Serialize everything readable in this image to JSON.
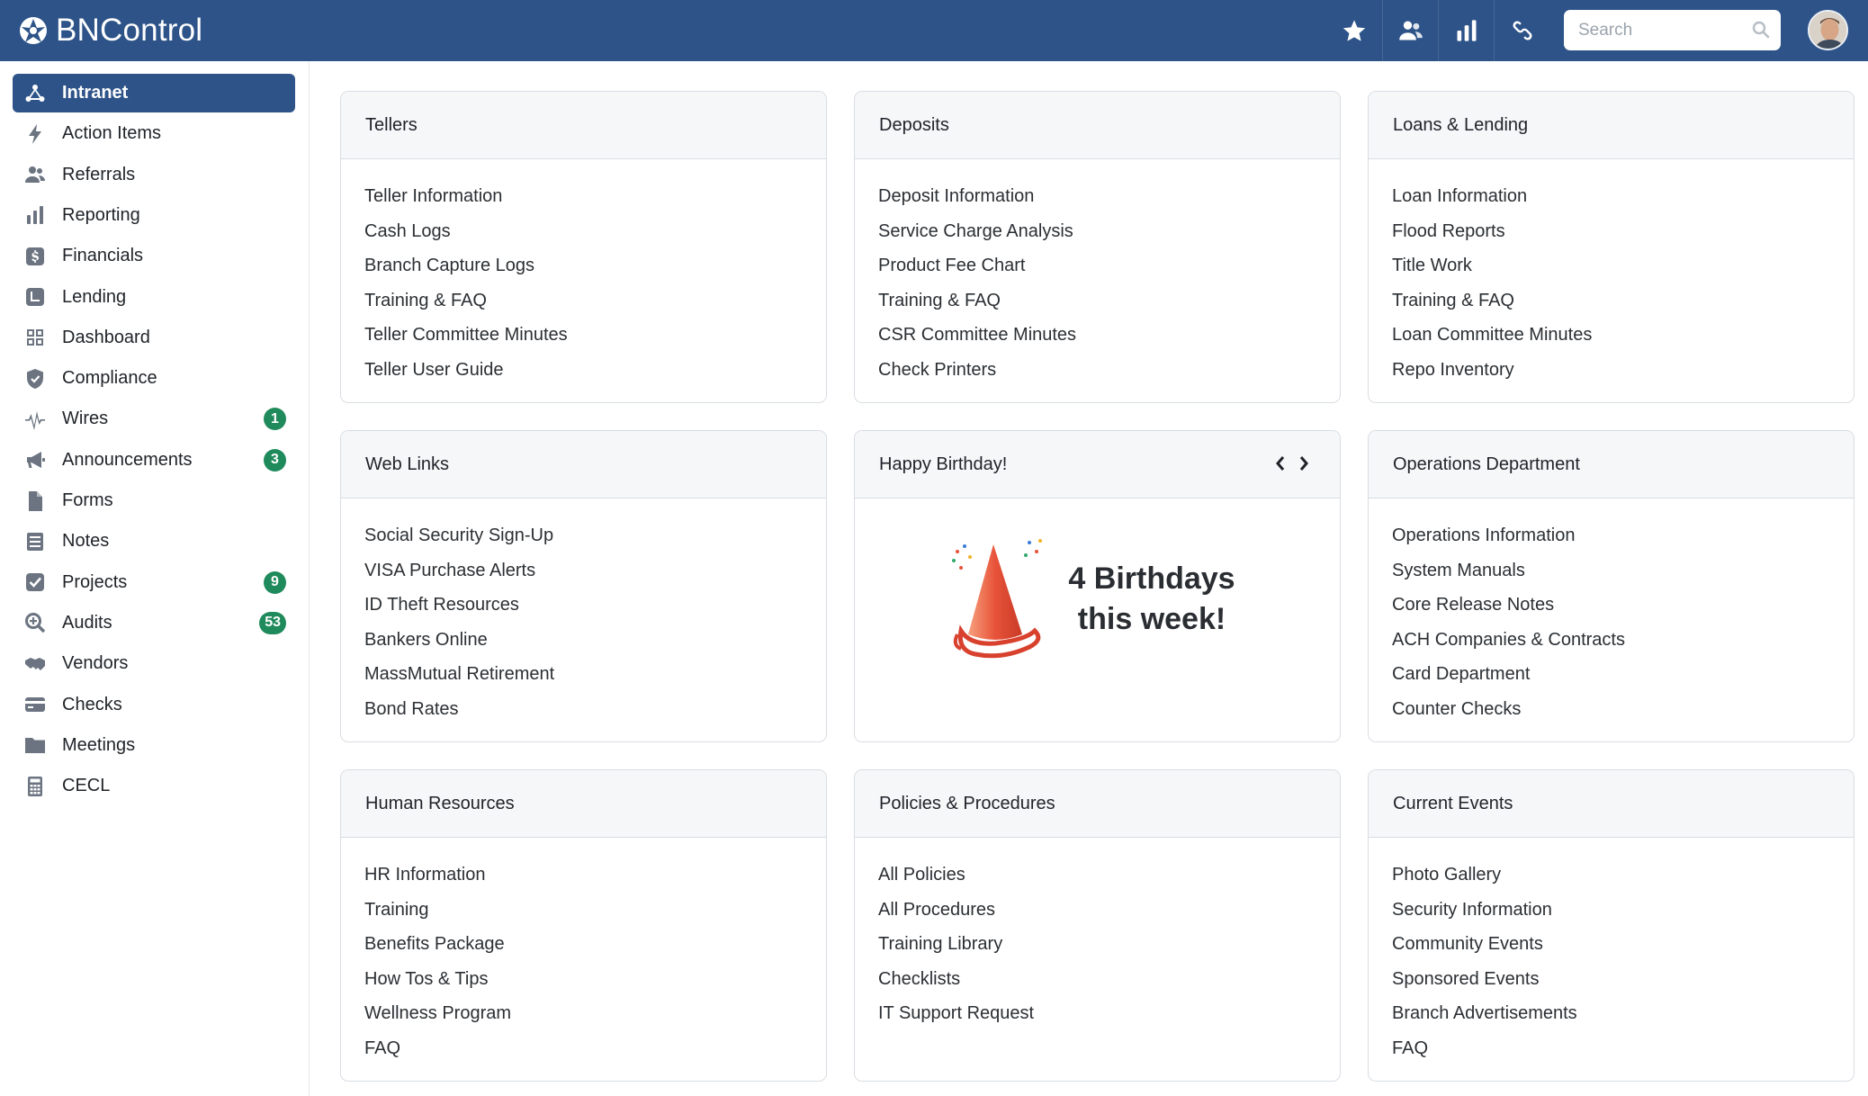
{
  "app": {
    "name": "BNControl"
  },
  "topbar": {
    "icons": [
      "star-icon",
      "users-icon",
      "bar-chart-icon",
      "link-icon"
    ],
    "search": {
      "placeholder": "Search",
      "value": ""
    }
  },
  "sidebar": {
    "items": [
      {
        "label": "Intranet",
        "icon": "network-icon",
        "active": true,
        "badge": ""
      },
      {
        "label": "Action Items",
        "icon": "bolt-icon",
        "badge": ""
      },
      {
        "label": "Referrals",
        "icon": "users-icon",
        "badge": ""
      },
      {
        "label": "Reporting",
        "icon": "bar-chart-icon",
        "badge": ""
      },
      {
        "label": "Financials",
        "icon": "dollar-icon",
        "badge": ""
      },
      {
        "label": "Lending",
        "icon": "lending-icon",
        "badge": ""
      },
      {
        "label": "Dashboard",
        "icon": "grid-icon",
        "badge": ""
      },
      {
        "label": "Compliance",
        "icon": "shield-icon",
        "badge": ""
      },
      {
        "label": "Wires",
        "icon": "pulse-icon",
        "badge": "1"
      },
      {
        "label": "Announcements",
        "icon": "megaphone-icon",
        "badge": "3"
      },
      {
        "label": "Forms",
        "icon": "file-icon",
        "badge": ""
      },
      {
        "label": "Notes",
        "icon": "notes-icon",
        "badge": ""
      },
      {
        "label": "Projects",
        "icon": "checkbox-icon",
        "badge": "9"
      },
      {
        "label": "Audits",
        "icon": "zoom-icon",
        "badge": "53"
      },
      {
        "label": "Vendors",
        "icon": "handshake-icon",
        "badge": ""
      },
      {
        "label": "Checks",
        "icon": "card-icon",
        "badge": ""
      },
      {
        "label": "Meetings",
        "icon": "folder-icon",
        "badge": ""
      },
      {
        "label": "CECL",
        "icon": "calculator-icon",
        "badge": ""
      }
    ]
  },
  "cards": {
    "tellers": {
      "title": "Tellers",
      "links": [
        "Teller Information",
        "Cash Logs",
        "Branch Capture Logs",
        "Training & FAQ",
        "Teller Committee Minutes",
        "Teller User Guide"
      ]
    },
    "deposits": {
      "title": "Deposits",
      "links": [
        "Deposit Information",
        "Service Charge Analysis",
        "Product Fee Chart",
        "Training & FAQ",
        "CSR Committee Minutes",
        "Check Printers"
      ]
    },
    "loans": {
      "title": "Loans & Lending",
      "links": [
        "Loan Information",
        "Flood Reports",
        "Title Work",
        "Training & FAQ",
        "Loan Committee Minutes",
        "Repo Inventory"
      ]
    },
    "weblinks": {
      "title": "Web Links",
      "links": [
        "Social Security Sign-Up",
        "VISA Purchase Alerts",
        "ID Theft Resources",
        "Bankers Online",
        "MassMutual Retirement",
        "Bond Rates"
      ]
    },
    "birthday": {
      "title": "Happy Birthday!",
      "line1": "4 Birthdays",
      "line2": "this week!"
    },
    "operations": {
      "title": "Operations Department",
      "links": [
        "Operations Information",
        "System Manuals",
        "Core Release Notes",
        "ACH Companies & Contracts",
        "Card Department",
        "Counter Checks"
      ]
    },
    "hr": {
      "title": "Human Resources",
      "links": [
        "HR Information",
        "Training",
        "Benefits Package",
        "How Tos & Tips",
        "Wellness Program",
        "FAQ"
      ]
    },
    "policies": {
      "title": "Policies & Procedures",
      "links": [
        "All Policies",
        "All Procedures",
        "Training Library",
        "Checklists",
        "IT Support Request"
      ]
    },
    "events": {
      "title": "Current Events",
      "links": [
        "Photo Gallery",
        "Security Information",
        "Community Events",
        "Sponsored Events",
        "Branch Advertisements",
        "FAQ"
      ]
    }
  },
  "colors": {
    "primary": "#2d5388",
    "badge": "#1f8a5b",
    "sidebar_icon": "#6b7480",
    "card_header": "#f5f7f9"
  }
}
